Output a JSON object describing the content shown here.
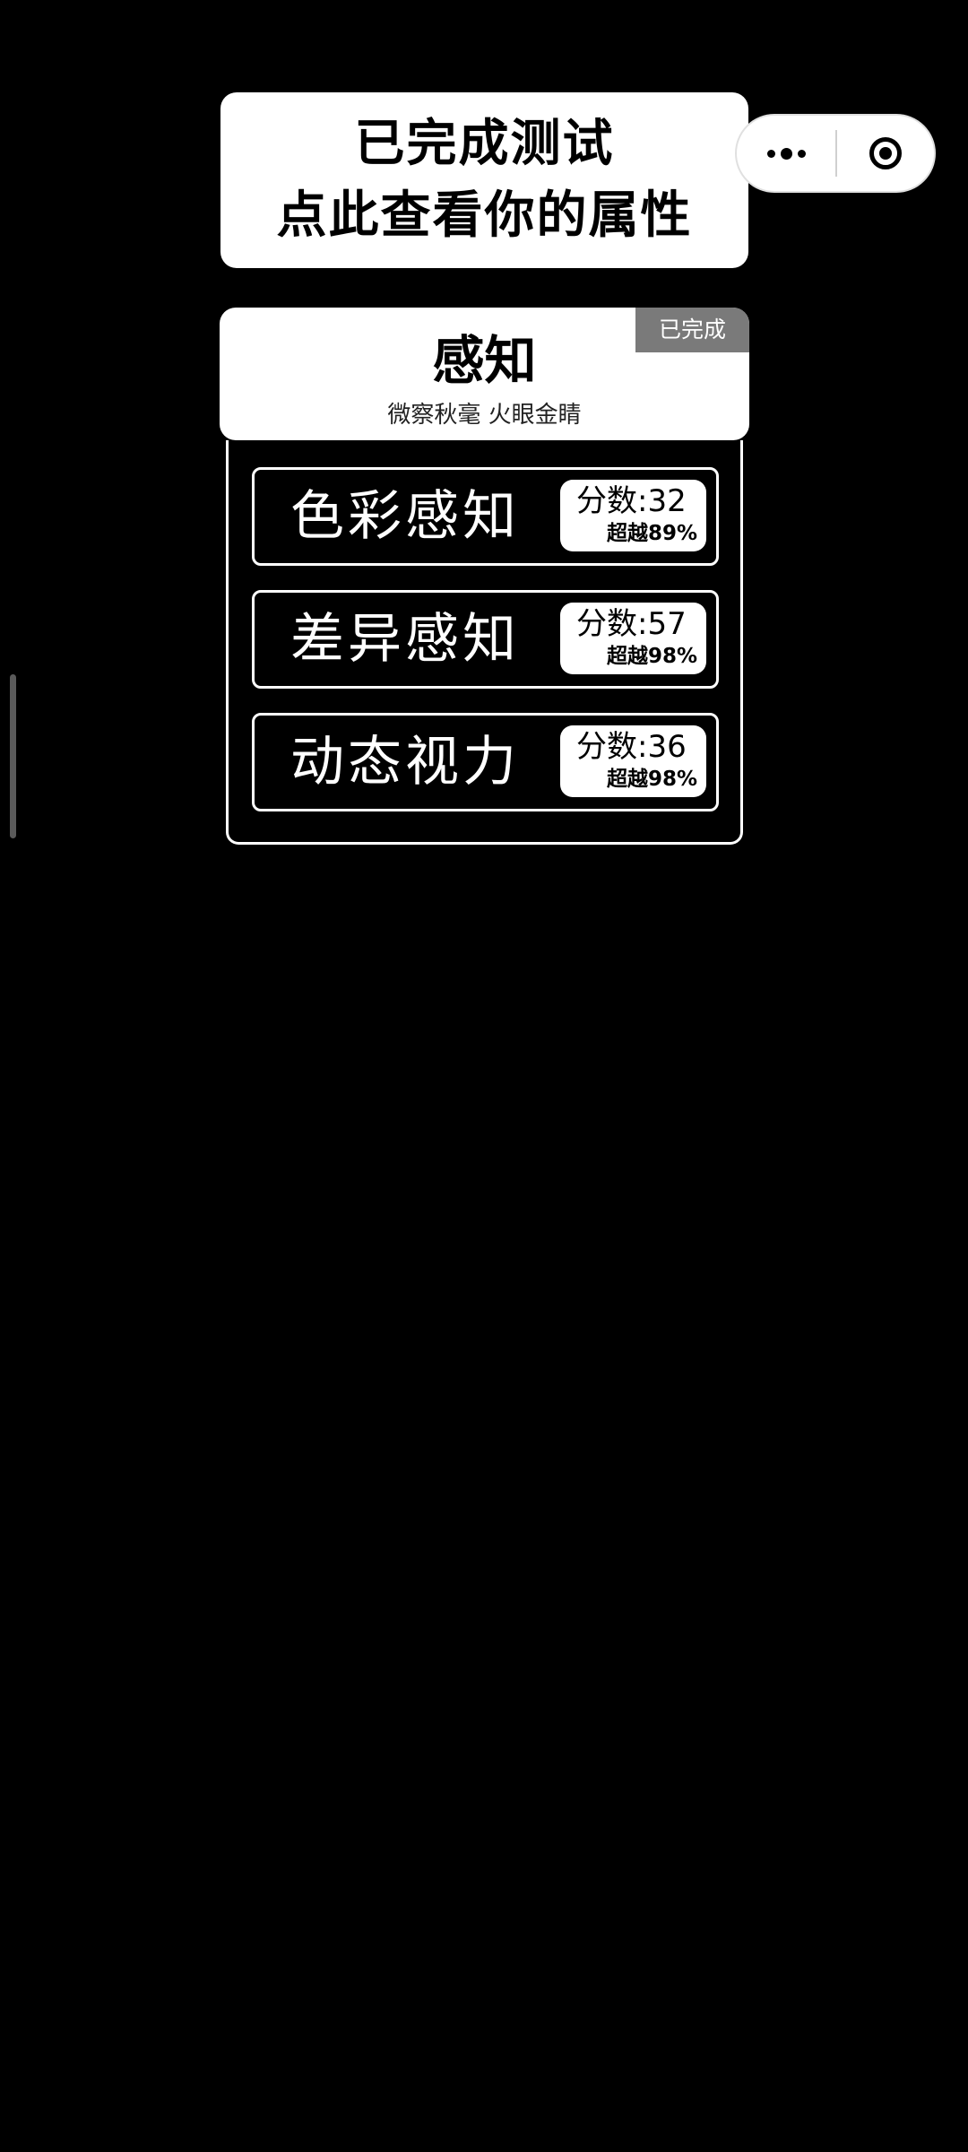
{
  "banner": {
    "line1": "已完成测试",
    "line2": "点此查看你的属性"
  },
  "capsule": {
    "more_icon": "more-dots-icon",
    "close_icon": "target-circle-icon"
  },
  "category": {
    "title": "感知",
    "subtitle": "微察秋毫 火眼金睛",
    "badge": "已完成"
  },
  "tests": [
    {
      "name": "色彩感知",
      "score": "分数:32",
      "beat": "超越89%"
    },
    {
      "name": "差异感知",
      "score": "分数:57",
      "beat": "超越98%"
    },
    {
      "name": "动态视力",
      "score": "分数:36",
      "beat": "超越98%"
    }
  ]
}
